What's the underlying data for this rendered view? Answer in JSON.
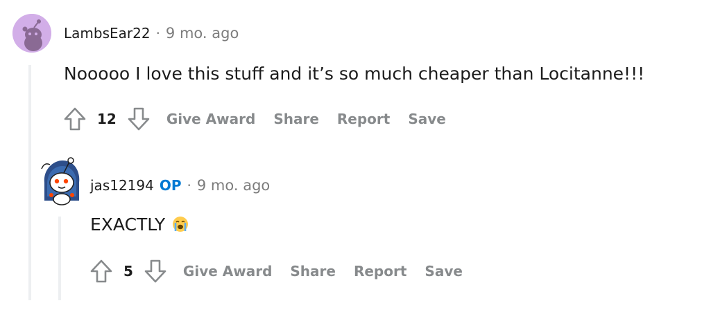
{
  "comments": [
    {
      "username": "LambsEar22",
      "separator": "·",
      "time": "9 mo. ago",
      "text": "Nooooo I love this stuff and it’s so much cheaper than Locitanne!!!",
      "score": "12",
      "actions": {
        "award": "Give Award",
        "share": "Share",
        "report": "Report",
        "save": "Save"
      },
      "avatar_color": "#c9a8e0"
    },
    {
      "username": "jas12194",
      "op_badge": "OP",
      "separator": "·",
      "time": "9 mo. ago",
      "text": "EXACTLY",
      "emoji": "loudly-crying-face-emoji",
      "score": "5",
      "actions": {
        "award": "Give Award",
        "share": "Share",
        "report": "Report",
        "save": "Save"
      }
    }
  ],
  "colors": {
    "op_badge": "#0079d3",
    "meta_gray": "#7c7c7c",
    "action_gray": "#878a8c",
    "thread_line": "#edeff1"
  }
}
